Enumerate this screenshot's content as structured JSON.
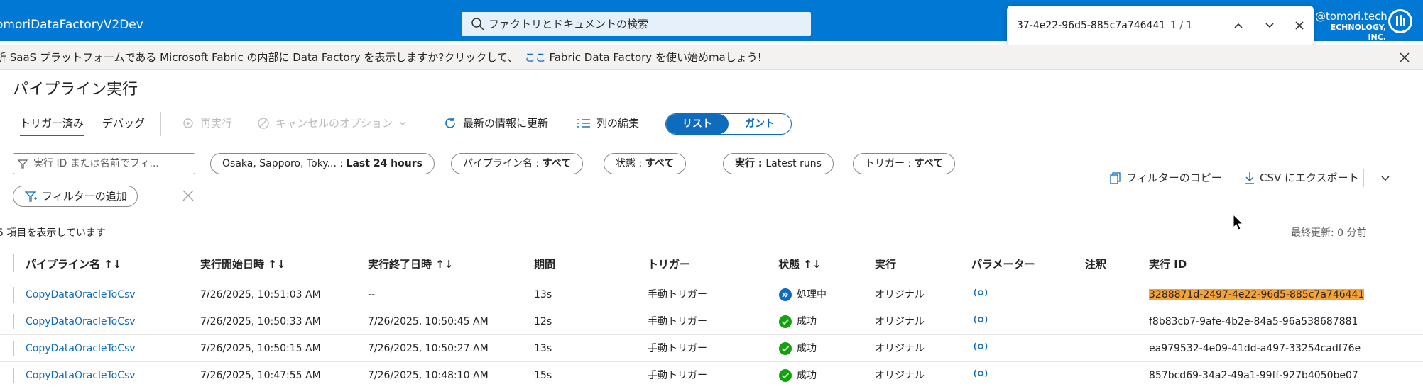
{
  "topbar": {
    "brand": "omoriDataFactoryV2Dev",
    "search_placeholder": "ファクトリとドキュメントの検索",
    "account_email": "@tomori.tech",
    "account_org": "ECHNOLOGY, INC."
  },
  "findbar": {
    "query": "37-4e22-96d5-885c7a746441",
    "count": "1 / 1"
  },
  "banner": {
    "text_before": "析 SaaS プラットフォームである Microsoft Fabric の内部に Data Factory を表示しますか?クリックして、",
    "link": "ここ",
    "text_after": " Fabric Data Factory を使い始めmaしょう!"
  },
  "page": {
    "title": "パイプライン実行"
  },
  "tabs": [
    {
      "label": "トリガー済み",
      "active": true
    },
    {
      "label": "デバッグ",
      "active": false
    }
  ],
  "toolbar": {
    "rerun": "再実行",
    "cancel_options": "キャンセルのオプション",
    "refresh": "最新の情報に更新",
    "edit_columns": "列の編集",
    "view_list": "リスト",
    "view_gantt": "ガント"
  },
  "filters": {
    "search_placeholder": "実行 ID または名前でフィ...",
    "time_label": "Osaka, Sapporo, Toky... : ",
    "time_value": "Last 24 hours",
    "pipeline_label": "パイプライン名 : ",
    "pipeline_value": "すべて",
    "status_label": "状態 : ",
    "status_value": "すべて",
    "run_label": "実行 : ",
    "run_value": "Latest runs",
    "trigger_label": "トリガー : ",
    "trigger_value": "すべて",
    "add_filter": "フィルターの追加"
  },
  "actions": {
    "copy_filter": "フィルターのコピー",
    "export_csv": "CSV にエクスポート"
  },
  "list": {
    "count_text": "5 項目を表示しています",
    "last_updated": "最終更新: 0 分前"
  },
  "columns": {
    "pipeline": "パイプライン名",
    "start": "実行開始日時",
    "end": "実行終了日時",
    "duration": "期間",
    "trigger": "トリガー",
    "status": "状態",
    "run": "実行",
    "params": "パラメーター",
    "annotation": "注釈",
    "runid": "実行 ID"
  },
  "rows": [
    {
      "pipeline": "CopyDataOracleToCsv",
      "start": "7/26/2025, 10:51:03 AM",
      "end": "--",
      "duration": "13s",
      "trigger": "手動トリガー",
      "status": "処理中",
      "run": "オリジナル",
      "runid": "3288871d-2497-4e22-96d5-885c7a746441"
    },
    {
      "pipeline": "CopyDataOracleToCsv",
      "start": "7/26/2025, 10:50:33 AM",
      "end": "7/26/2025, 10:50:45 AM",
      "duration": "12s",
      "trigger": "手動トリガー",
      "status": "成功",
      "run": "オリジナル",
      "runid": "f8b83cb7-9afe-4b2e-84a5-96a538687881"
    },
    {
      "pipeline": "CopyDataOracleToCsv",
      "start": "7/26/2025, 10:50:15 AM",
      "end": "7/26/2025, 10:50:27 AM",
      "duration": "13s",
      "trigger": "手動トリガー",
      "status": "成功",
      "run": "オリジナル",
      "runid": "ea979532-4e09-41dd-a497-33254cadf76e"
    },
    {
      "pipeline": "CopyDataOracleToCsv",
      "start": "7/26/2025, 10:47:55 AM",
      "end": "7/26/2025, 10:48:10 AM",
      "duration": "15s",
      "trigger": "手動トリガー",
      "status": "成功",
      "run": "オリジナル",
      "runid": "857bcd69-34a2-49a1-99ff-927b4050be07"
    }
  ],
  "colors": {
    "accent": "#0078d4",
    "link": "#0f6cbd",
    "success": "#13a10e",
    "highlight": "#f7a234"
  }
}
